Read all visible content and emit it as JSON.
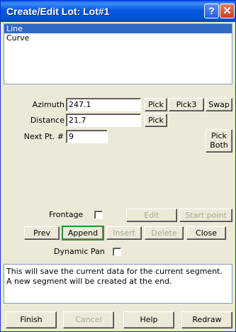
{
  "window": {
    "title": "Create/Edit Lot: Lot#1",
    "help_glyph": "?",
    "close_glyph": "✕"
  },
  "segment_types": [
    "Line",
    "Curve"
  ],
  "selected_segment_type": "Line",
  "fields": {
    "azimuth_label": "Azimuth",
    "azimuth_value": "247.1",
    "distance_label": "Distance",
    "distance_value": "21.7",
    "next_pt_label": "Next Pt. #",
    "next_pt_value": "9"
  },
  "buttons": {
    "pick_azimuth": "Pick",
    "pick3": "Pick3",
    "swap": "Swap",
    "pick_distance": "Pick",
    "pick_both_line1": "Pick",
    "pick_both_line2": "Both",
    "edit": "Edit",
    "start_point": "Start point",
    "prev": "Prev",
    "append": "Append",
    "insert": "Insert",
    "delete": "Delete",
    "close": "Close",
    "finish": "Finish",
    "cancel": "Cancel",
    "help": "Help",
    "redraw": "Redraw"
  },
  "options": {
    "frontage_label": "Frontage",
    "frontage_checked": false,
    "dynamic_pan_label": "Dynamic Pan",
    "dynamic_pan_checked": false
  },
  "message": "This will save the current data for the current segment. A new segment will be created at the end."
}
